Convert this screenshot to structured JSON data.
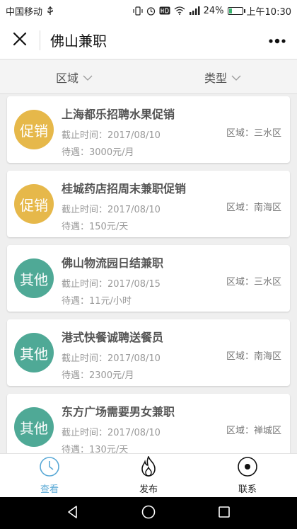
{
  "status": {
    "carrier": "中国移动",
    "battery": "24%",
    "battery_level": 0.24,
    "time": "上午10:30"
  },
  "header": {
    "title": "佛山兼职",
    "close_icon": "close-icon",
    "more_icon": "more-dots-icon"
  },
  "filters": [
    {
      "label": "区域"
    },
    {
      "label": "类型"
    }
  ],
  "jobs": [
    {
      "badge": "促销",
      "badge_color": "#e6b84a",
      "title": "上海都乐招聘水果促销",
      "deadline": "截止时间：2017/08/10",
      "salary": "待遇：3000元/月",
      "area": "区域：三水区"
    },
    {
      "badge": "促销",
      "badge_color": "#e6b84a",
      "title": "桂城药店招周末兼职促销",
      "deadline": "截止时间：2017/08/10",
      "salary": "待遇：150元/天",
      "area": "区域：南海区"
    },
    {
      "badge": "其他",
      "badge_color": "#4fa996",
      "title": "佛山物流园日结兼职",
      "deadline": "截止时间：2017/08/15",
      "salary": "待遇：11元/小时",
      "area": "区域：三水区"
    },
    {
      "badge": "其他",
      "badge_color": "#4fa996",
      "title": "港式快餐诚聘送餐员",
      "deadline": "截止时间：2017/08/10",
      "salary": "待遇：2300元/月",
      "area": "区域：南海区"
    },
    {
      "badge": "其他",
      "badge_color": "#4fa996",
      "title": "东方广场需要男女兼职",
      "deadline": "截止时间：2017/08/10",
      "salary": "待遇：130元/天",
      "area": "区域：禅城区"
    }
  ],
  "tabs": [
    {
      "label": "查看",
      "icon": "clock-icon",
      "active": true
    },
    {
      "label": "发布",
      "icon": "fire-icon",
      "active": false
    },
    {
      "label": "联系",
      "icon": "contact-icon",
      "active": false
    }
  ],
  "colors": {
    "accent": "#5aa9d6",
    "promo": "#e6b84a",
    "other": "#4fa996"
  }
}
